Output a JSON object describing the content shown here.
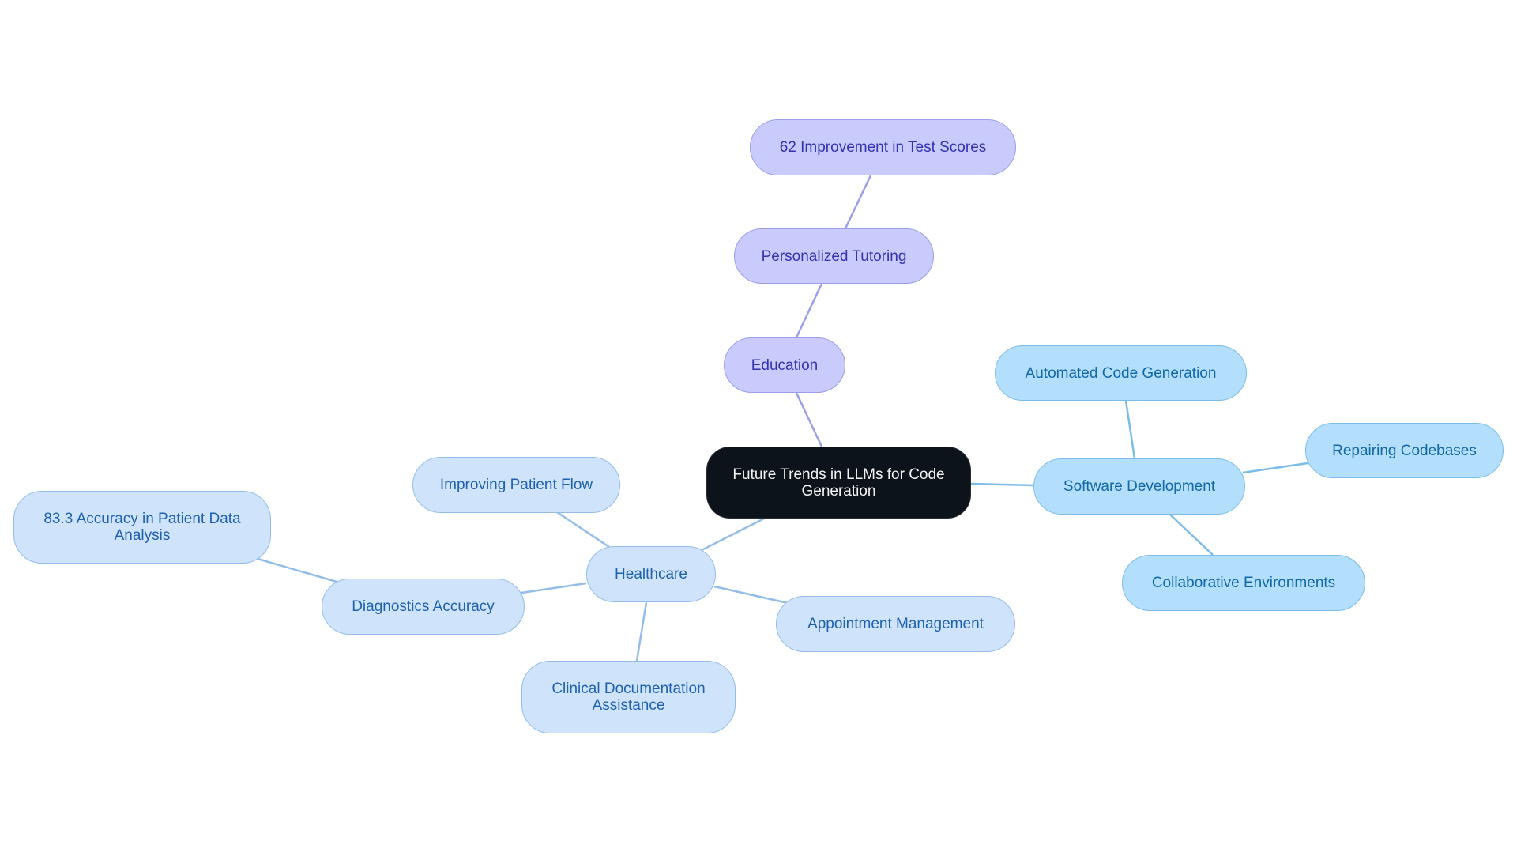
{
  "diagram": {
    "type": "mindmap",
    "colors": {
      "root_fill": "#0c131b",
      "root_text": "#f2f2f2",
      "education_fill": "#c8cbfc",
      "education_stroke": "#9b9ee8",
      "education_text": "#3532b0",
      "software_fill": "#b3defc",
      "software_stroke": "#7bbde8",
      "software_text": "#1169a8",
      "healthcare_fill": "#cfe3fb",
      "healthcare_stroke": "#93bde8",
      "healthcare_text": "#1e62b0"
    },
    "root": {
      "label": "Future Trends in LLMs for Code Generation"
    },
    "branches": {
      "education": {
        "label": "Education",
        "children": {
          "tutoring": {
            "label": "Personalized Tutoring",
            "children": {
              "test_scores": {
                "label": "62 Improvement in Test Scores"
              }
            }
          }
        }
      },
      "software": {
        "label": "Software Development",
        "children": {
          "automated": {
            "label": "Automated Code Generation"
          },
          "repairing": {
            "label": "Repairing Codebases"
          },
          "collaborative": {
            "label": "Collaborative Environments"
          }
        }
      },
      "healthcare": {
        "label": "Healthcare",
        "children": {
          "patient_flow": {
            "label": "Improving Patient Flow"
          },
          "diagnostics": {
            "label": "Diagnostics Accuracy",
            "children": {
              "accuracy": {
                "label": "83.3 Accuracy in Patient Data Analysis"
              }
            }
          },
          "clinical": {
            "label": "Clinical Documentation Assistance"
          },
          "appointment": {
            "label": "Appointment Management"
          }
        }
      }
    },
    "edges": [
      [
        "root",
        "education"
      ],
      [
        "education",
        "tutoring"
      ],
      [
        "tutoring",
        "test_scores"
      ],
      [
        "root",
        "software"
      ],
      [
        "software",
        "automated"
      ],
      [
        "software",
        "repairing"
      ],
      [
        "software",
        "collaborative"
      ],
      [
        "root",
        "healthcare"
      ],
      [
        "healthcare",
        "patient_flow"
      ],
      [
        "healthcare",
        "diagnostics"
      ],
      [
        "diagnostics",
        "accuracy"
      ],
      [
        "healthcare",
        "clinical"
      ],
      [
        "healthcare",
        "appointment"
      ]
    ]
  }
}
